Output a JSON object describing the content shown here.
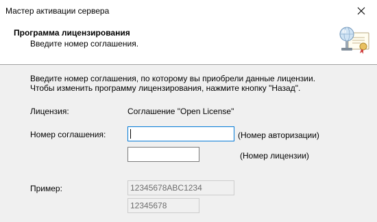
{
  "window": {
    "title": "Мастер активации сервера"
  },
  "header": {
    "title": "Программа лицензирования",
    "subtitle": "Введите номер соглашения."
  },
  "intro": {
    "line1": "Введите номер соглашения, по которому вы приобрели данные лицензии.",
    "line2": "Чтобы изменить программу лицензирования, нажмите кнопку \"Назад\"."
  },
  "license": {
    "label": "Лицензия:",
    "value": "Соглашение \"Open License\""
  },
  "agreement": {
    "label": "Номер соглашения:",
    "auth_value": "",
    "auth_hint": "(Номер авторизации)",
    "license_value": "",
    "license_hint": "(Номер лицензии)"
  },
  "example": {
    "label": "Пример:",
    "auth_example": "12345678ABC1234",
    "license_example": "12345678"
  },
  "colors": {
    "focus_border": "#0078d7",
    "panel_bg": "#f0f0f0"
  }
}
